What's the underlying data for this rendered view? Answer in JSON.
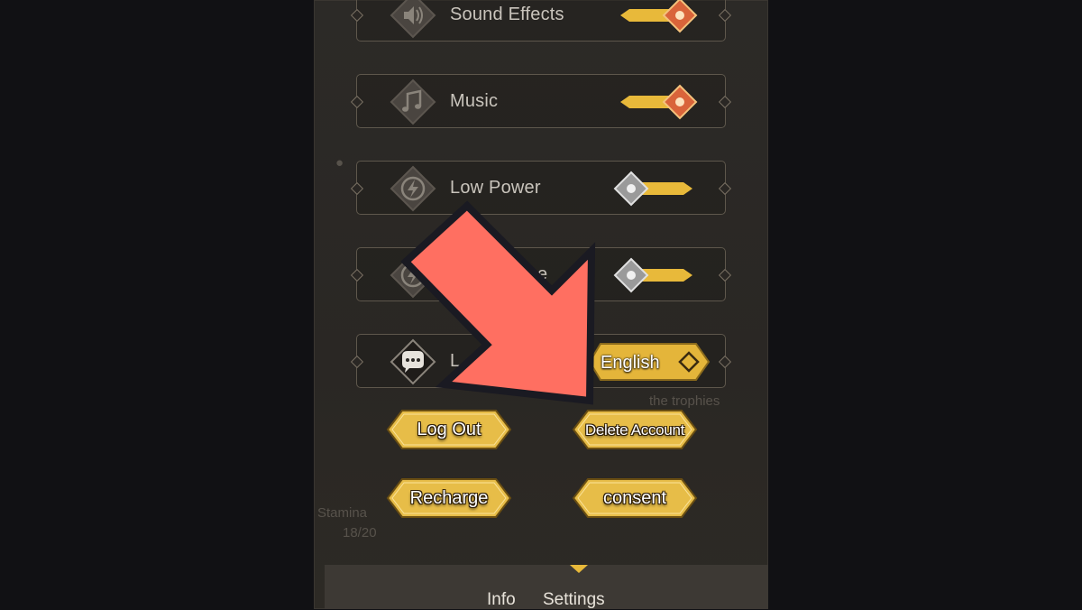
{
  "settings_rows": {
    "sound_effects": {
      "label": "Sound Effects",
      "icon": "speaker-icon",
      "state": "on"
    },
    "music": {
      "label": "Music",
      "icon": "music-note-icon",
      "state": "on"
    },
    "low_power": {
      "label": "Low Power",
      "icon": "lightning-icon",
      "state": "off"
    },
    "row4": {
      "label": "e",
      "icon": "lightning-icon",
      "state": "off"
    },
    "language": {
      "label": "L",
      "icon": "chat-bubble-icon",
      "value": "English"
    }
  },
  "buttons": {
    "log_out": "Log Out",
    "delete_account": "Delete Account",
    "recharge": "Recharge",
    "consent": "consent"
  },
  "tabs": {
    "info": "Info",
    "settings": "Settings",
    "active": "settings"
  },
  "colors": {
    "gold": "#e8b93a",
    "knob_on": "#d9643a",
    "knob_off": "#9a9a9a",
    "arrow": "#ff6f61"
  }
}
